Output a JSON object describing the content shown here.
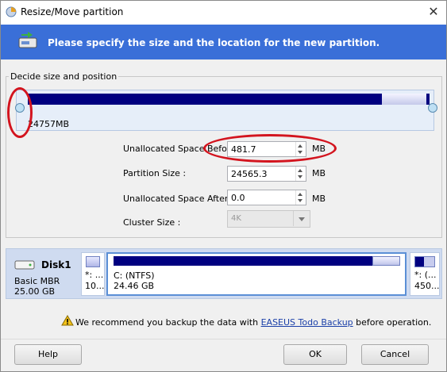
{
  "window": {
    "title": "Resize/Move partition",
    "close_icon": "close-icon"
  },
  "banner": {
    "text": "Please specify the size and the location for the new partition.",
    "icon": "partition-resize-icon"
  },
  "group": {
    "label": "Decide size and position",
    "partition_size_label": "24757MB",
    "used_fraction": 0.85
  },
  "fields": {
    "unalloc_before_label": "Unallocated Space Before:",
    "unalloc_before_value": "481.7",
    "partition_size_label": "Partition Size :",
    "partition_size_value": "24565.3",
    "unalloc_after_label": "Unallocated Space After:",
    "unalloc_after_value": "0.0",
    "cluster_label": "Cluster Size :",
    "cluster_value": "4K",
    "unit": "MB"
  },
  "disk": {
    "name": "Disk1",
    "type": "Basic MBR",
    "size": "25.00 GB",
    "partitions": [
      {
        "name": "*: ...",
        "size": "10..."
      },
      {
        "name": "C: (NTFS)",
        "size": "24.46 GB"
      },
      {
        "name": "*: (...",
        "size": "450..."
      }
    ]
  },
  "warning": {
    "prefix": "We recommend you backup the data with ",
    "link": "EASEUS Todo Backup",
    "suffix": " before operation."
  },
  "buttons": {
    "help": "Help",
    "ok": "OK",
    "cancel": "Cancel"
  },
  "colors": {
    "banner": "#3a6fd8",
    "partition_used": "#000080",
    "annotation": "#d3141e"
  }
}
